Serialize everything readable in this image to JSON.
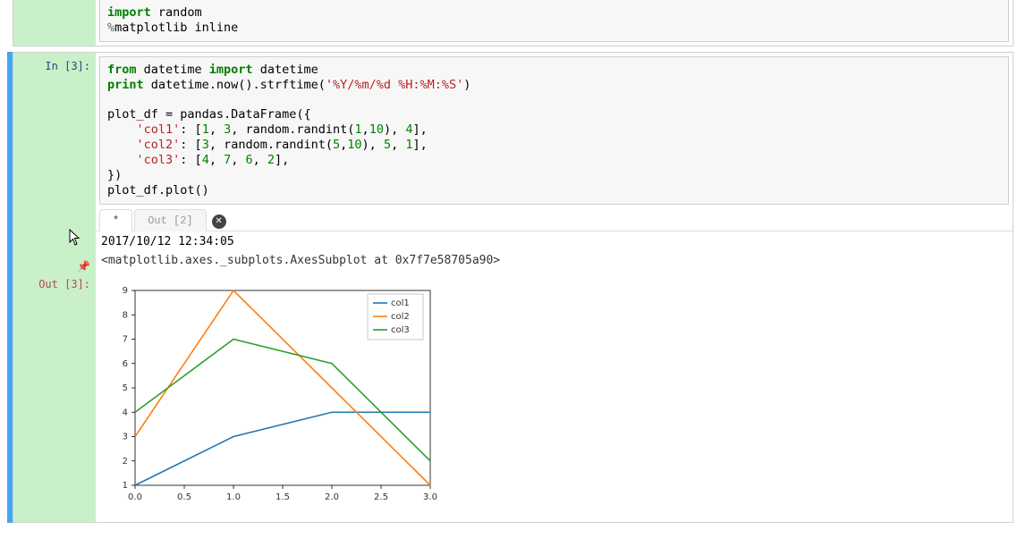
{
  "cell0": {
    "code_html": "<span class='kw-green'>import</span> random\n<span class='op'>%</span>matplotlib inline"
  },
  "cell1": {
    "in_prompt": "In [3]:",
    "out_prompt": "Out [3]:",
    "pin_glyph": "📌",
    "code_html": "<span class='kw-green'>from</span> datetime <span class='kw-green'>import</span> datetime\n<span class='kw-green'>print</span> datetime.now().strftime(<span class='str-red'>'%Y/%m/%d %H:%M:%S'</span>)\n\nplot_df = pandas.DataFrame({\n    <span class='str-red'>'col1'</span>: [<span class='num-green'>1</span>, <span class='num-green'>3</span>, random.randint(<span class='num-green'>1</span>,<span class='num-green'>10</span>), <span class='num-green'>4</span>],\n    <span class='str-red'>'col2'</span>: [<span class='num-green'>3</span>, random.randint(<span class='num-green'>5</span>,<span class='num-green'>10</span>), <span class='num-green'>5</span>, <span class='num-green'>1</span>],\n    <span class='str-red'>'col3'</span>: [<span class='num-green'>4</span>, <span class='num-green'>7</span>, <span class='num-green'>6</span>, <span class='num-green'>2</span>],\n})\nplot_df.plot()",
    "tabs": {
      "active": "*",
      "inactive": "Out [2]"
    },
    "stdout": "2017/10/12 12:34:05",
    "repr": "<matplotlib.axes._subplots.AxesSubplot at 0x7f7e58705a90>"
  },
  "chart_data": {
    "type": "line",
    "x": [
      0.0,
      1.0,
      2.0,
      3.0
    ],
    "series": [
      {
        "name": "col1",
        "values": [
          1,
          3,
          4,
          4
        ],
        "color": "#1f77b4"
      },
      {
        "name": "col2",
        "values": [
          3,
          9,
          5,
          1
        ],
        "color": "#ff7f0e"
      },
      {
        "name": "col3",
        "values": [
          4,
          7,
          6,
          2
        ],
        "color": "#2ca02c"
      }
    ],
    "xticks": [
      0.0,
      0.5,
      1.0,
      1.5,
      2.0,
      2.5,
      3.0
    ],
    "yticks": [
      1,
      2,
      3,
      4,
      5,
      6,
      7,
      8,
      9
    ],
    "xlim": [
      0.0,
      3.0
    ],
    "ylim": [
      1,
      9
    ]
  }
}
